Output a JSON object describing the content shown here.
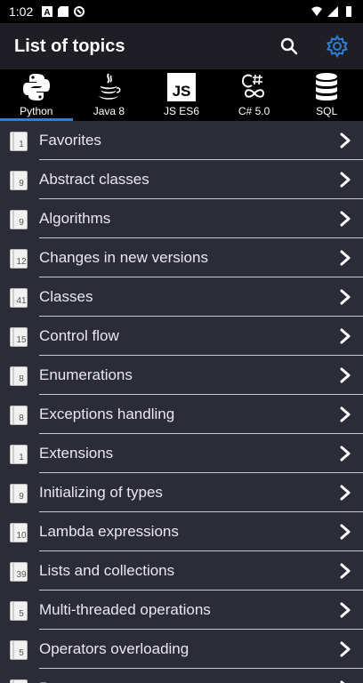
{
  "status_bar": {
    "time": "1:02"
  },
  "app_bar": {
    "title": "List of topics",
    "search_icon": "search-icon",
    "settings_icon": "gear-icon",
    "accent": "#2f7fd6"
  },
  "tabs": [
    {
      "label": "Python",
      "icon": "python-logo-icon",
      "active": true
    },
    {
      "label": "Java 8",
      "icon": "java-logo-icon",
      "active": false
    },
    {
      "label": "JS ES6",
      "icon": "js-logo-icon",
      "active": false
    },
    {
      "label": "C# 5.0",
      "icon": "csharp-logo-icon",
      "active": false
    },
    {
      "label": "SQL",
      "icon": "database-icon",
      "active": false
    }
  ],
  "topics": [
    {
      "label": "Favorites",
      "count": "1"
    },
    {
      "label": "Abstract classes",
      "count": "9"
    },
    {
      "label": "Algorithms",
      "count": "9"
    },
    {
      "label": "Changes in new versions",
      "count": "12"
    },
    {
      "label": "Classes",
      "count": "41"
    },
    {
      "label": "Control flow",
      "count": "15"
    },
    {
      "label": "Enumerations",
      "count": "8"
    },
    {
      "label": "Exceptions handling",
      "count": "8"
    },
    {
      "label": "Extensions",
      "count": "1"
    },
    {
      "label": "Initializing of types",
      "count": "9"
    },
    {
      "label": "Lambda expressions",
      "count": "10"
    },
    {
      "label": "Lists and collections",
      "count": "39"
    },
    {
      "label": "Multi-threaded operations",
      "count": "5"
    },
    {
      "label": "Operators overloading",
      "count": "5"
    },
    {
      "label": "Patterns",
      "count": ""
    }
  ]
}
